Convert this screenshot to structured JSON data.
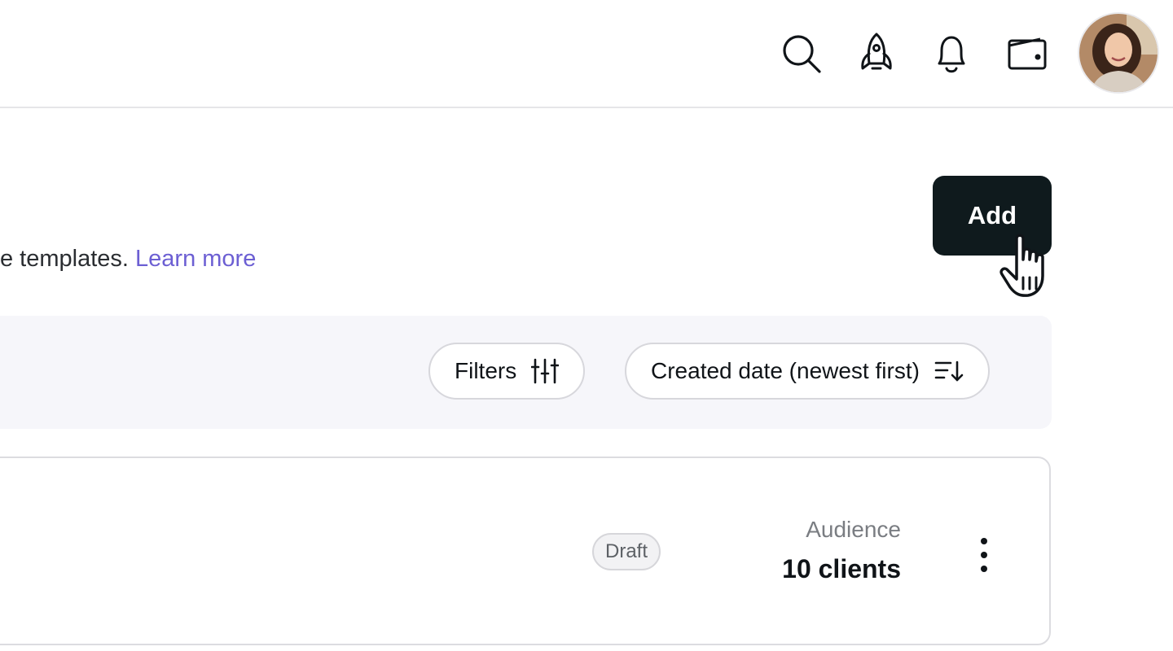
{
  "header": {
    "icons": [
      "search-icon",
      "rocket-icon",
      "bell-icon",
      "wallet-icon"
    ],
    "avatar": "user-avatar"
  },
  "intro": {
    "text": "e templates. ",
    "link_label": "Learn more"
  },
  "actions": {
    "add_label": "Add"
  },
  "toolbar": {
    "filters_label": "Filters",
    "sort_label": "Created date (newest first)"
  },
  "item": {
    "status": "Draft",
    "audience_label": "Audience",
    "audience_value": "10 clients"
  },
  "colors": {
    "accent": "#6c5fd3",
    "primary_button": "#0f1a1d",
    "toolbar_bg": "#f6f6fa"
  }
}
